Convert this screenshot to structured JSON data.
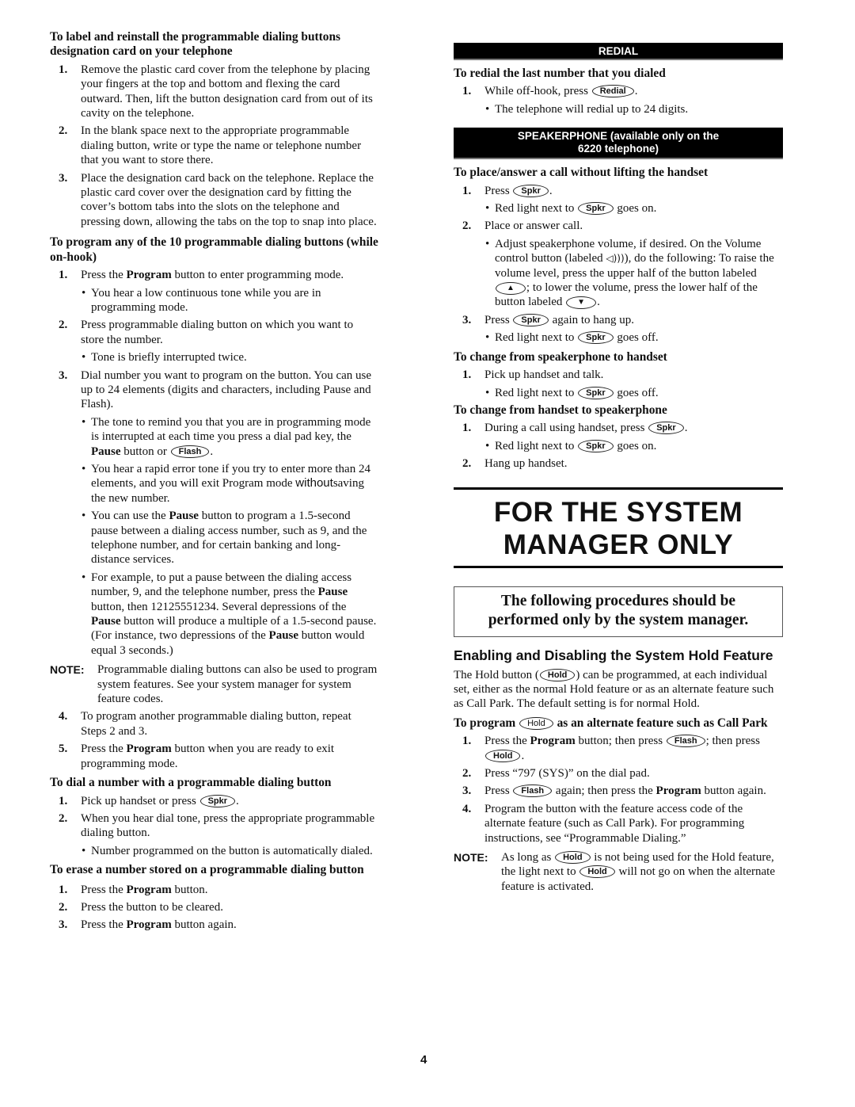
{
  "left": {
    "label_card": {
      "heading": "To label and reinstall the programmable dialing buttons designation card on your telephone",
      "steps": [
        {
          "num": "1.",
          "text": "Remove the plastic card cover from the telephone by placing your fingers at the top and bottom and flexing the card outward. Then, lift the button designation card from out of its cavity on the telephone."
        },
        {
          "num": "2.",
          "text": "In the blank space next to the appropriate programmable dialing button, write or type the name or telephone number that you want to store there."
        },
        {
          "num": "3.",
          "text": "Place the designation card back on the telephone. Replace the plastic card cover over the designation card by fitting the cover’s bottom tabs into the slots on the telephone and pressing down, allowing the tabs on the top to snap into place."
        }
      ]
    },
    "program_buttons": {
      "heading": "To program any of the 10 programmable dialing buttons (while on-hook)",
      "step1": {
        "num": "1.",
        "pre": "Press the ",
        "bold": "Program",
        "post": " button to enter programming mode."
      },
      "step1_bullet": "You hear a low continuous tone while you are in programming mode.",
      "step2": {
        "num": "2.",
        "text": "Press programmable dialing button on which you want to store the number."
      },
      "step2_bullet": "Tone is briefly interrupted twice.",
      "step3": {
        "num": "3.",
        "text": "Dial number you want to program on the button. You can use up to 24 elements (digits and characters, including Pause and Flash)."
      },
      "step3_bullets": {
        "b1_pre": "The tone to remind you that you are in programming mode is interrupted at each time you press a dial pad key, the ",
        "b1_bold": "Pause",
        "b1_mid": " button or ",
        "b1_key": "Flash",
        "b1_post": ".",
        "b2_pre": "You hear a rapid error tone if you try to enter more than 24 elements, and you will exit Program mode ",
        "b2_sans": "without",
        "b2_post": "saving the new number.",
        "b3_pre": "You can use the ",
        "b3_bold": "Pause",
        "b3_post": " button to program a 1.5-second pause between a dialing access number, such as 9, and the telephone number, and for certain banking and long-distance services.",
        "b4_pre": "For example, to put a pause between the dialing access number, 9, and the telephone number, press the ",
        "b4_bold1": "Pause",
        "b4_mid1": " button, then 12125551234. Several depressions of the ",
        "b4_bold2": "Pause",
        "b4_mid2": " button will produce a multiple of a 1.5-second pause. (For instance, two depressions of the ",
        "b4_bold3": "Pause",
        "b4_post": " button would equal 3 seconds.)"
      },
      "note_label": "NOTE:",
      "note_text": "Programmable dialing buttons can also be used to program system features. See your system manager for system feature codes.",
      "step4": {
        "num": "4.",
        "text": "To program another programmable dialing button, repeat Steps 2 and 3."
      },
      "step5": {
        "num": "5.",
        "pre": "Press the ",
        "bold": "Program",
        "post": " button when you are ready to exit programming mode."
      }
    },
    "dial_number": {
      "heading": "To dial a number with a programmable dialing button",
      "step1": {
        "num": "1.",
        "pre": "Pick up handset or press ",
        "key": "Spkr",
        "post": "."
      },
      "step2": {
        "num": "2.",
        "text": "When you hear dial tone, press the appropriate programmable dialing button."
      },
      "step2_bullet": "Number programmed on the button is automatically dialed."
    },
    "erase_number": {
      "heading": "To erase a number stored on a programmable dialing button",
      "step1": {
        "num": "1.",
        "pre": "Press the ",
        "bold": "Program",
        "post": " button."
      },
      "step2": {
        "num": "2.",
        "text": "Press the button to be cleared."
      },
      "step3": {
        "num": "3.",
        "pre": "Press the ",
        "bold": "Program",
        "post": " button again."
      }
    }
  },
  "right": {
    "redial_bar": "REDIAL",
    "redial": {
      "heading": "To redial the last number that you dialed",
      "step1": {
        "num": "1.",
        "pre": "While off-hook, press ",
        "key": "Redial",
        "post": "."
      },
      "bullet": "The telephone will redial up to 24 digits."
    },
    "speaker_bar_line1": "SPEAKERPHONE (available only on the",
    "speaker_bar_line2": "6220 telephone)",
    "place_answer": {
      "heading": "To place/answer a call without lifting the handset",
      "step1": {
        "num": "1.",
        "pre": "Press ",
        "key": "Spkr",
        "post": "."
      },
      "step1_bullet": {
        "pre": "Red light next to ",
        "key": "Spkr",
        "post": " goes on."
      },
      "step2": {
        "num": "2.",
        "text": "Place or answer call."
      },
      "step2_bullet": {
        "pre": "Adjust speakerphone volume, if desired. On the Volume control button (labeled ",
        "icon": "◁)))",
        "mid1": "), do the following: To raise the volume level, press the upper half of the button labeled ",
        "up_key": "▲",
        "mid2": "; to lower the volume, press the lower half of the button labeled ",
        "down_key": "▼",
        "post": "."
      },
      "step3": {
        "num": "3.",
        "pre": "Press ",
        "key": "Spkr",
        "post": " again to hang up."
      },
      "step3_bullet": {
        "pre": "Red light next to ",
        "key": "Spkr",
        "post": " goes off."
      }
    },
    "speaker_to_handset": {
      "heading": "To change from speakerphone to handset",
      "step1": {
        "num": "1.",
        "text": "Pick up handset and talk."
      },
      "step1_bullet": {
        "pre": "Red light next to ",
        "key": "Spkr",
        "post": " goes off."
      }
    },
    "handset_to_speaker": {
      "heading": "To change from handset to speakerphone",
      "step1": {
        "num": "1.",
        "pre": "During a call using handset, press ",
        "key": "Spkr",
        "post": "."
      },
      "step1_bullet": {
        "pre": "Red light next to ",
        "key": "Spkr",
        "post": " goes on."
      },
      "step2": {
        "num": "2.",
        "text": "Hang up handset."
      }
    },
    "big_title_line1": "FOR THE SYSTEM",
    "big_title_line2": "MANAGER ONLY",
    "notice_line1": "The following procedures should be",
    "notice_line2": "performed only by the system manager.",
    "hold_section": {
      "title": "Enabling and Disabling the System Hold Feature",
      "intro_pre": "The Hold button (",
      "intro_key": "Hold",
      "intro_post": ") can be programmed, at each individual set, either as the normal Hold feature or as an alternate feature such as Call Park. The default setting is for normal Hold.",
      "heading_pre": "To program ",
      "heading_key": "Hold",
      "heading_post": " as an alternate feature such as Call Park",
      "step1": {
        "num": "1.",
        "pre": "Press the ",
        "bold": "Program",
        "mid": " button; then press ",
        "key1": "Flash",
        "mid2": "; then press ",
        "key2": "Hold",
        "post": "."
      },
      "step2": {
        "num": "2.",
        "text": "Press “797 (SYS)” on the dial pad."
      },
      "step3": {
        "num": "3.",
        "pre": "Press ",
        "key": "Flash",
        "mid": " again; then press the ",
        "bold": "Program",
        "post": " button again."
      },
      "step4": {
        "num": "4.",
        "text": "Program the button with the feature access code of the alternate feature (such as Call Park). For programming instructions, see “Programmable Dialing.”"
      },
      "note_label": "NOTE:",
      "note_pre": "As long as ",
      "note_key1": "Hold",
      "note_mid": " is not being used for the Hold feature, the light next to ",
      "note_key2": "Hold",
      "note_post": " will not go on when the alternate feature is activated."
    }
  },
  "page_number": "4"
}
